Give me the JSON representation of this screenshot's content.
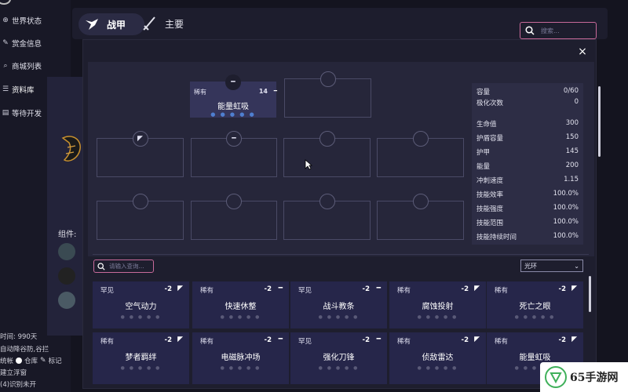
{
  "sidebar": {
    "items": [
      {
        "icon": "globe-icon",
        "glyph": "⊕",
        "label": "世界状态"
      },
      {
        "icon": "bounty-icon",
        "glyph": "✎",
        "label": "赏金信息"
      },
      {
        "icon": "search-icon",
        "glyph": "⌕",
        "label": "商城列表"
      },
      {
        "icon": "list-icon",
        "glyph": "☰",
        "label": "资料库"
      },
      {
        "icon": "doc-icon",
        "glyph": "▤",
        "label": "等待开发"
      }
    ],
    "bottom_time": "时间: 990天",
    "bottom_line1": "自动降谷防,谷拦",
    "bottom_line2_a": "统帐",
    "bottom_line2_b": "仓库",
    "bottom_line2_c": "标记",
    "bottom_line3": "建立浮窗",
    "bottom_line4": "(4)识别未开"
  },
  "behind": {
    "label": "组件:"
  },
  "topbar": {
    "tab_active": "战甲",
    "tab_main": "主要",
    "search_placeholder": "搜索..."
  },
  "dialog": {
    "close": "×",
    "slots": [
      {
        "rarity": "稀有",
        "cost": "14",
        "name": "能量虹吸",
        "dots": "● ● ● ● ●",
        "polarity": "━",
        "filled": true
      },
      {
        "polarity": "",
        "filled": false
      },
      {
        "polarity": "◤",
        "filled": false
      },
      {
        "polarity": "━",
        "filled": false
      },
      {
        "polarity": "",
        "filled": false
      },
      {
        "polarity": "",
        "filled": false
      },
      {
        "polarity": "",
        "filled": false
      },
      {
        "polarity": "",
        "filled": false
      },
      {
        "polarity": "",
        "filled": false
      },
      {
        "polarity": "",
        "filled": false
      }
    ],
    "stats": [
      {
        "label": "容量",
        "value": "0/60"
      },
      {
        "label": "极化次数",
        "value": "0"
      },
      {
        "label": "生命值",
        "value": "300"
      },
      {
        "label": "护盾容量",
        "value": "150"
      },
      {
        "label": "护甲",
        "value": "145"
      },
      {
        "label": "能量",
        "value": "200"
      },
      {
        "label": "冲刺速度",
        "value": "1.15"
      },
      {
        "label": "技能效率",
        "value": "100.0%"
      },
      {
        "label": "技能强度",
        "value": "100.0%"
      },
      {
        "label": "技能范围",
        "value": "100.0%"
      },
      {
        "label": "技能持续时间",
        "value": "100.0%"
      }
    ],
    "mod_search_placeholder": "请输入查询...",
    "aura_select": "光环",
    "cards": [
      {
        "rarity": "罕见",
        "cost": "-2",
        "name": "空气动力"
      },
      {
        "rarity": "稀有",
        "cost": "-2",
        "name": "快速休整"
      },
      {
        "rarity": "罕见",
        "cost": "-2",
        "name": "战斗教条"
      },
      {
        "rarity": "稀有",
        "cost": "-2",
        "name": "腐蚀投射"
      },
      {
        "rarity": "稀有",
        "cost": "-2",
        "name": "死亡之眼"
      },
      {
        "rarity": "稀有",
        "cost": "-2",
        "name": "梦者羁绊"
      },
      {
        "rarity": "稀有",
        "cost": "-2",
        "name": "电磁脉冲场"
      },
      {
        "rarity": "罕见",
        "cost": "-2",
        "name": "强化刀锋"
      },
      {
        "rarity": "稀有",
        "cost": "-2",
        "name": "侦敌雷达"
      },
      {
        "rarity": "稀有",
        "cost": "-2",
        "name": "能量虹吸"
      }
    ],
    "card_dots": "● ● ● ● ●"
  },
  "watermark": {
    "text": "65手游网"
  }
}
